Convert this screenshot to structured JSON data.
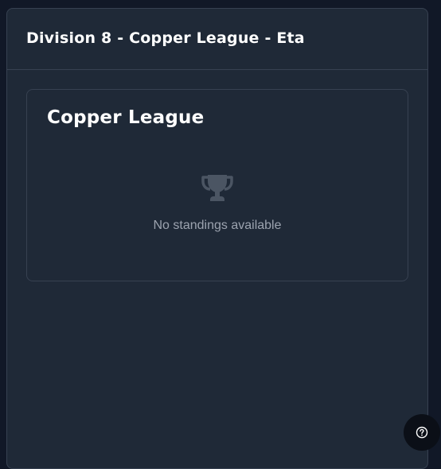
{
  "division": {
    "title": "Division 8 - Copper League - Eta"
  },
  "league": {
    "title": "Copper League",
    "empty_icon": "trophy-icon",
    "empty_message": "No standings available"
  },
  "help": {
    "icon": "help-circle-icon"
  },
  "colors": {
    "page_background": "#111827",
    "panel_background": "#1f2937",
    "border": "#374151",
    "muted_text": "#9ca3af",
    "icon_muted": "#4b5563"
  }
}
